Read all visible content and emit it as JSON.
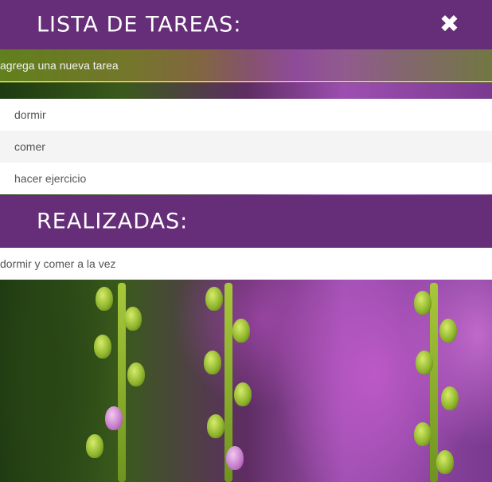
{
  "todo": {
    "title": "LISTA DE TAREAS:",
    "close_icon": "✖",
    "input_placeholder": "agrega una nueva tarea",
    "tasks": [
      "dormir",
      "comer",
      "hacer ejercicio"
    ]
  },
  "done": {
    "title": "REALIZADAS:",
    "tasks": [
      "dormir y comer a la vez"
    ]
  },
  "colors": {
    "header_bg": "#662d78",
    "header_text": "#ffffff",
    "item_text": "#555555"
  }
}
